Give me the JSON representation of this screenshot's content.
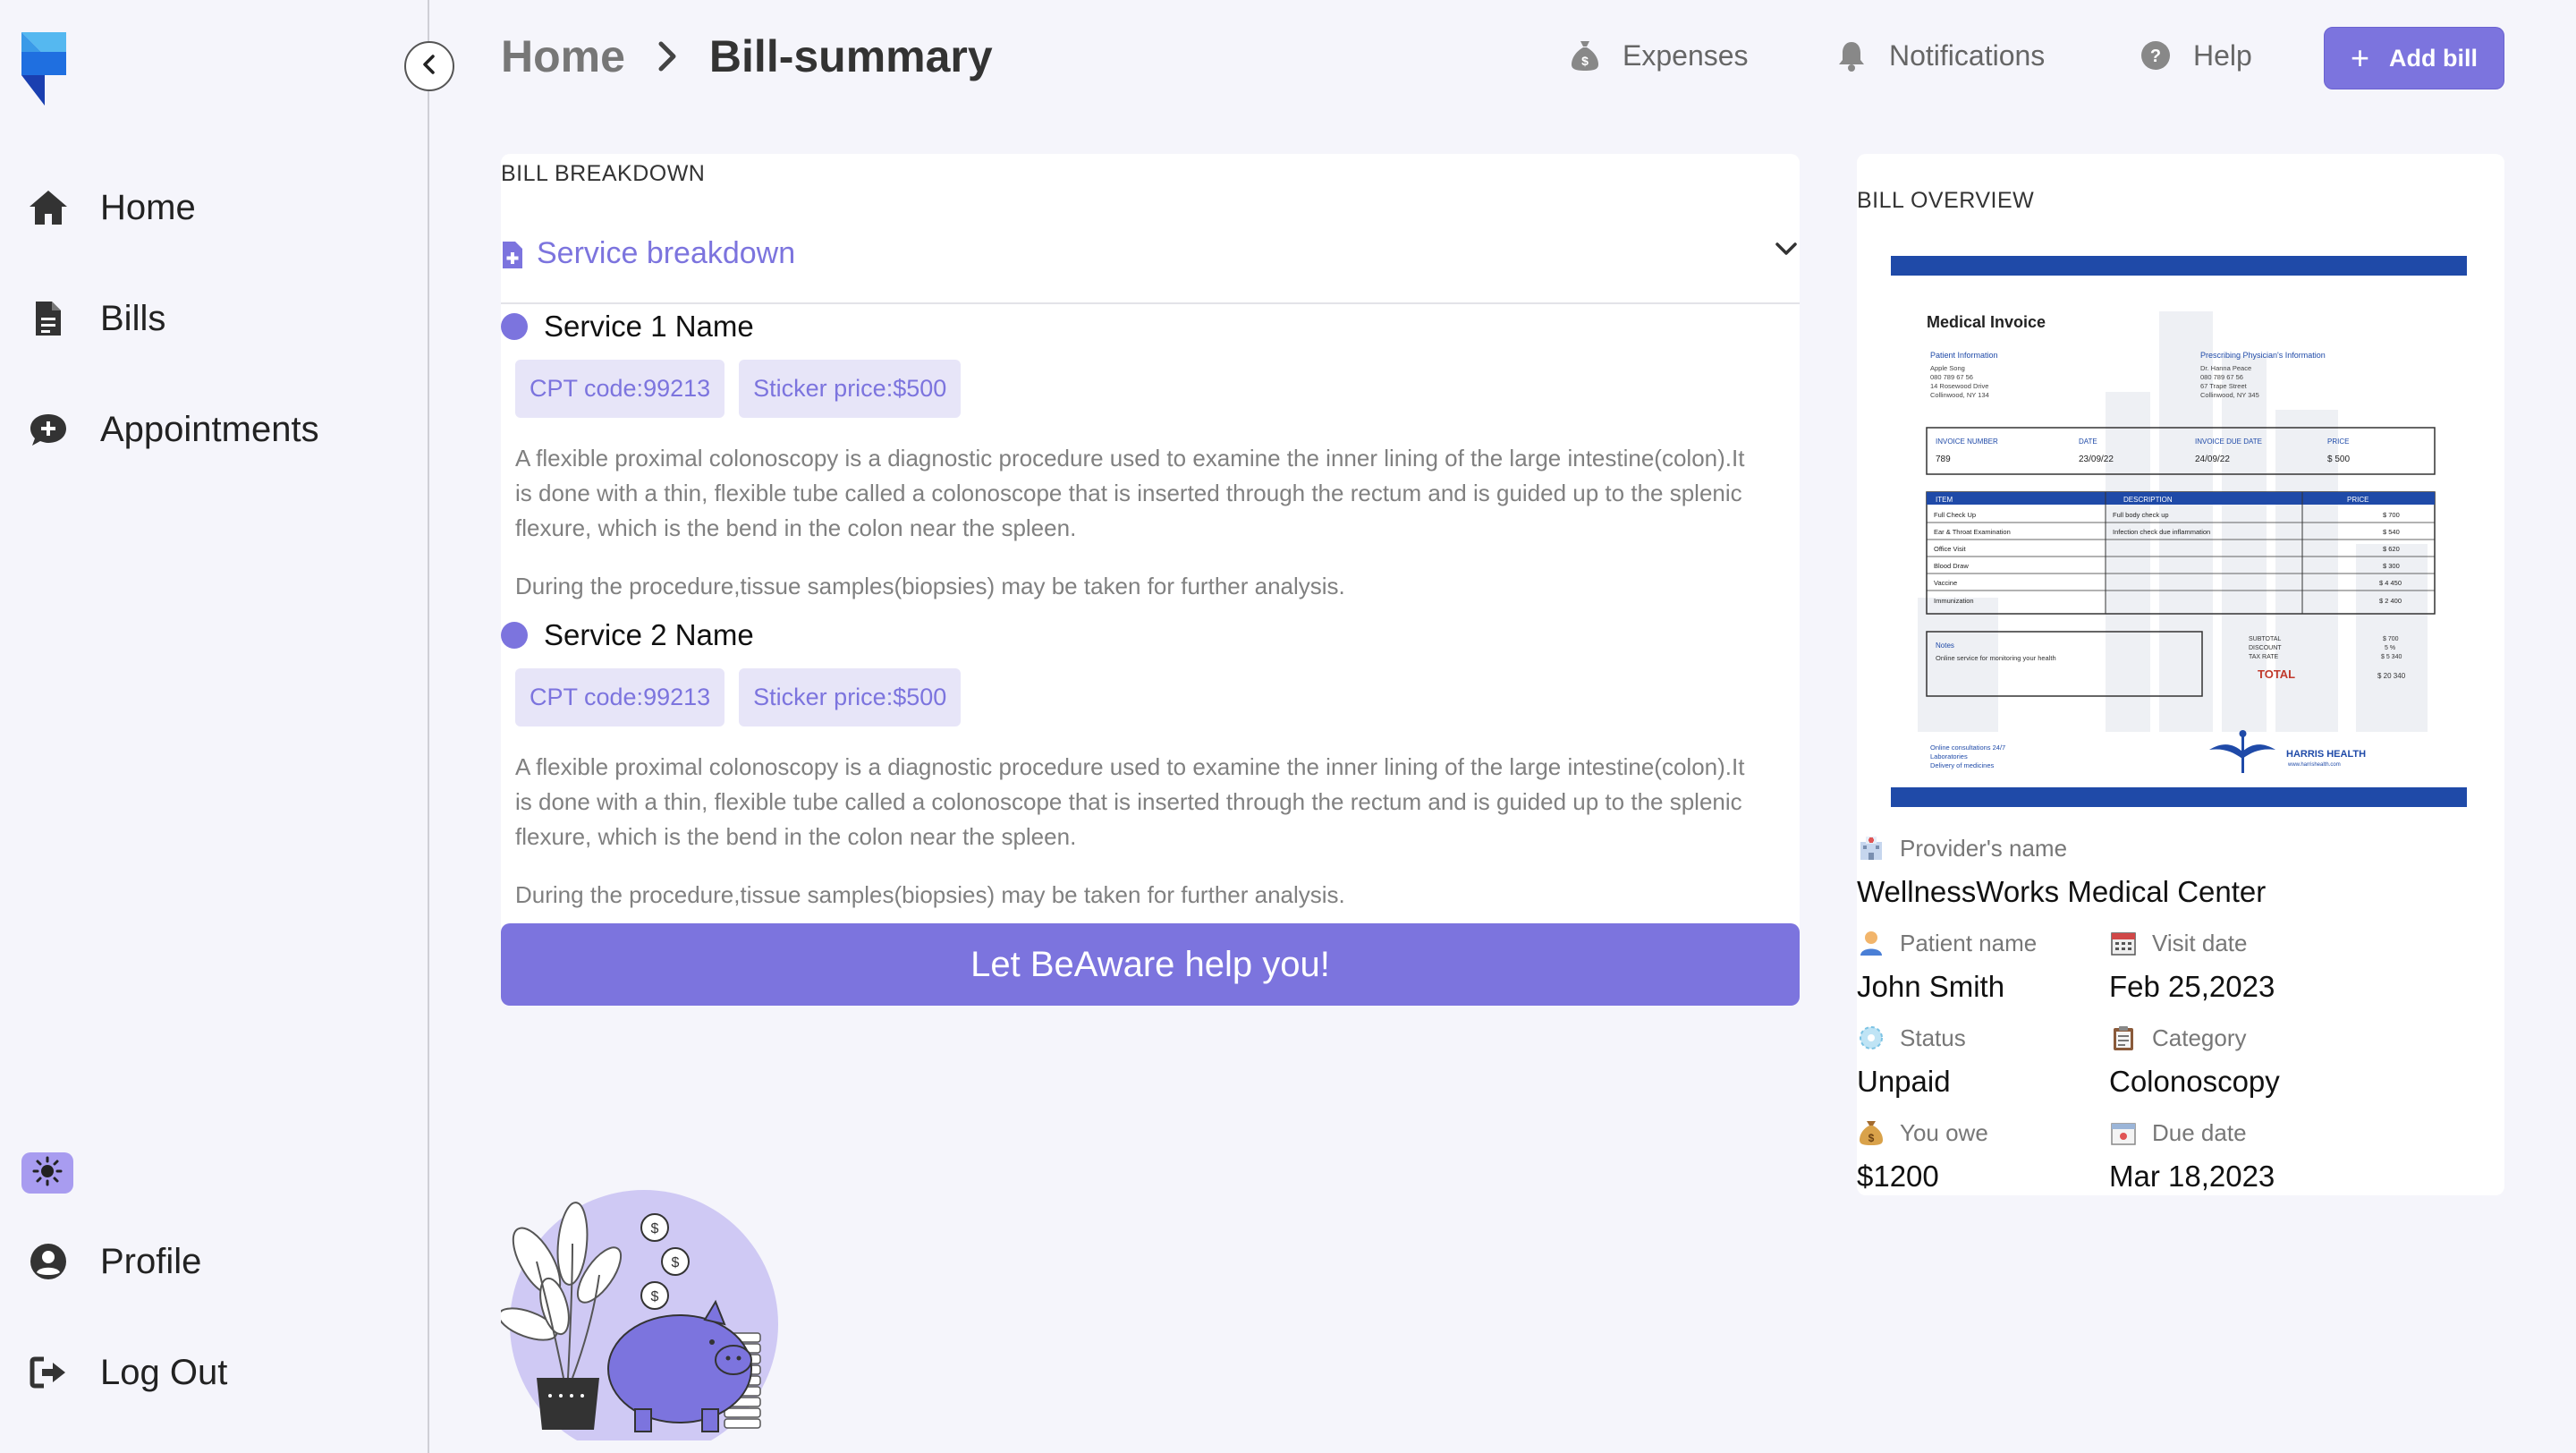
{
  "header": {
    "breadcrumb_home": "Home",
    "breadcrumb_current": "Bill-summary",
    "links": [
      {
        "label": "Expenses",
        "icon": "money-bag-icon"
      },
      {
        "label": "Notifications",
        "icon": "bell-icon"
      },
      {
        "label": "Help",
        "icon": "question-circle-icon"
      }
    ],
    "add_bill_label": "Add bill"
  },
  "sidebar": {
    "items": [
      {
        "label": "Home",
        "icon": "home-icon"
      },
      {
        "label": "Bills",
        "icon": "document-icon"
      },
      {
        "label": "Appointments",
        "icon": "chat-plus-icon"
      }
    ],
    "bottom_items": [
      {
        "label": "Profile",
        "icon": "user-circle-icon"
      },
      {
        "label": "Log Out",
        "icon": "logout-icon"
      }
    ]
  },
  "breakdown": {
    "title": "BILL BREAKDOWN",
    "accordion_title": "Service breakdown",
    "services": [
      {
        "name": "Service 1 Name",
        "cpt": "CPT code:99213",
        "price": "Sticker price:$500",
        "description": "A flexible proximal colonoscopy is a diagnostic procedure used to examine the inner lining of the large intestine(colon).It is done with a thin, flexible tube called a colonoscope that is inserted through the rectum and is guided up to the splenic flexure, which is the bend in the colon near the spleen.",
        "note": "During the procedure,tissue samples(biopsies) may be taken for further analysis."
      },
      {
        "name": "Service 2 Name",
        "cpt": "CPT code:99213",
        "price": "Sticker price:$500",
        "description": "A flexible proximal colonoscopy is a diagnostic procedure used to examine the inner lining of the large intestine(colon).It is done with a thin, flexible tube called a colonoscope that is inserted through the rectum and is guided up to the splenic flexure, which is the bend in the colon near the spleen.",
        "note": "During the procedure,tissue samples(biopsies) may be taken for further analysis."
      }
    ],
    "help_button": "Let BeAware help you!"
  },
  "overview": {
    "title": "BILL OVERVIEW",
    "invoice": {
      "heading": "Medical Invoice",
      "patient_info": "Patient Information",
      "physician_info": "Prescribing Physician's Information",
      "patient_lines": [
        "Apple Song",
        "080 789 67 56",
        "14 Rosewood Drive",
        "Collinwood, NY 134"
      ],
      "physician_lines": [
        "Dr. Hanna Peace",
        "080 789 67 56",
        "67 Trape Street",
        "Collinwood, NY 345"
      ],
      "meta_headers": [
        "INVOICE NUMBER",
        "DATE",
        "INVOICE DUE DATE",
        "PRICE"
      ],
      "meta_values": [
        "789",
        "23/09/22",
        "24/09/22",
        "$ 500"
      ],
      "table_headers": [
        "ITEM",
        "DESCRIPTION",
        "PRICE"
      ],
      "rows": [
        [
          "Full Check Up",
          "Full body check up",
          "$ 700"
        ],
        [
          "Ear & Throat Examination",
          "Infection check due inflammation",
          "$ 540"
        ],
        [
          "Office Visit",
          "",
          "$ 620"
        ],
        [
          "Blood Draw",
          "",
          "$ 300"
        ],
        [
          "Vaccine",
          "",
          "$ 4 450"
        ],
        [
          "Immunization",
          "",
          "$ 2 400"
        ]
      ],
      "notes_label": "Notes",
      "notes_text": "Online service for monitoring your health",
      "subtotal_labels": [
        "SUBTOTAL",
        "DISCOUNT",
        "TAX RATE"
      ],
      "subtotal_values": [
        "$ 700",
        "5 %",
        "$ 5 340"
      ],
      "total_label": "TOTAL",
      "total_value": "$ 20 340",
      "footer_lines": [
        "Online consultations 24/7",
        "Laboratories",
        "Delivery of medicines"
      ],
      "brand": "HARRIS HEALTH",
      "brand_url": "www.harrishealth.com"
    },
    "provider_label": "Provider's name",
    "provider_value": "WellnessWorks Medical Center",
    "patient_label": "Patient name",
    "patient_value": "John Smith",
    "visit_label": "Visit date",
    "visit_value": "Feb 25,2023",
    "status_label": "Status",
    "status_value": "Unpaid",
    "category_label": "Category",
    "category_value": "Colonoscopy",
    "owe_label": "You owe",
    "owe_value": "$1200",
    "due_label": "Due date",
    "due_value": "Mar 18,2023"
  },
  "colors": {
    "accent": "#7c74de",
    "chip_bg": "#e7e5f8",
    "page_bg": "#f5f5fb",
    "invoice_blue": "#1f4aa8"
  }
}
